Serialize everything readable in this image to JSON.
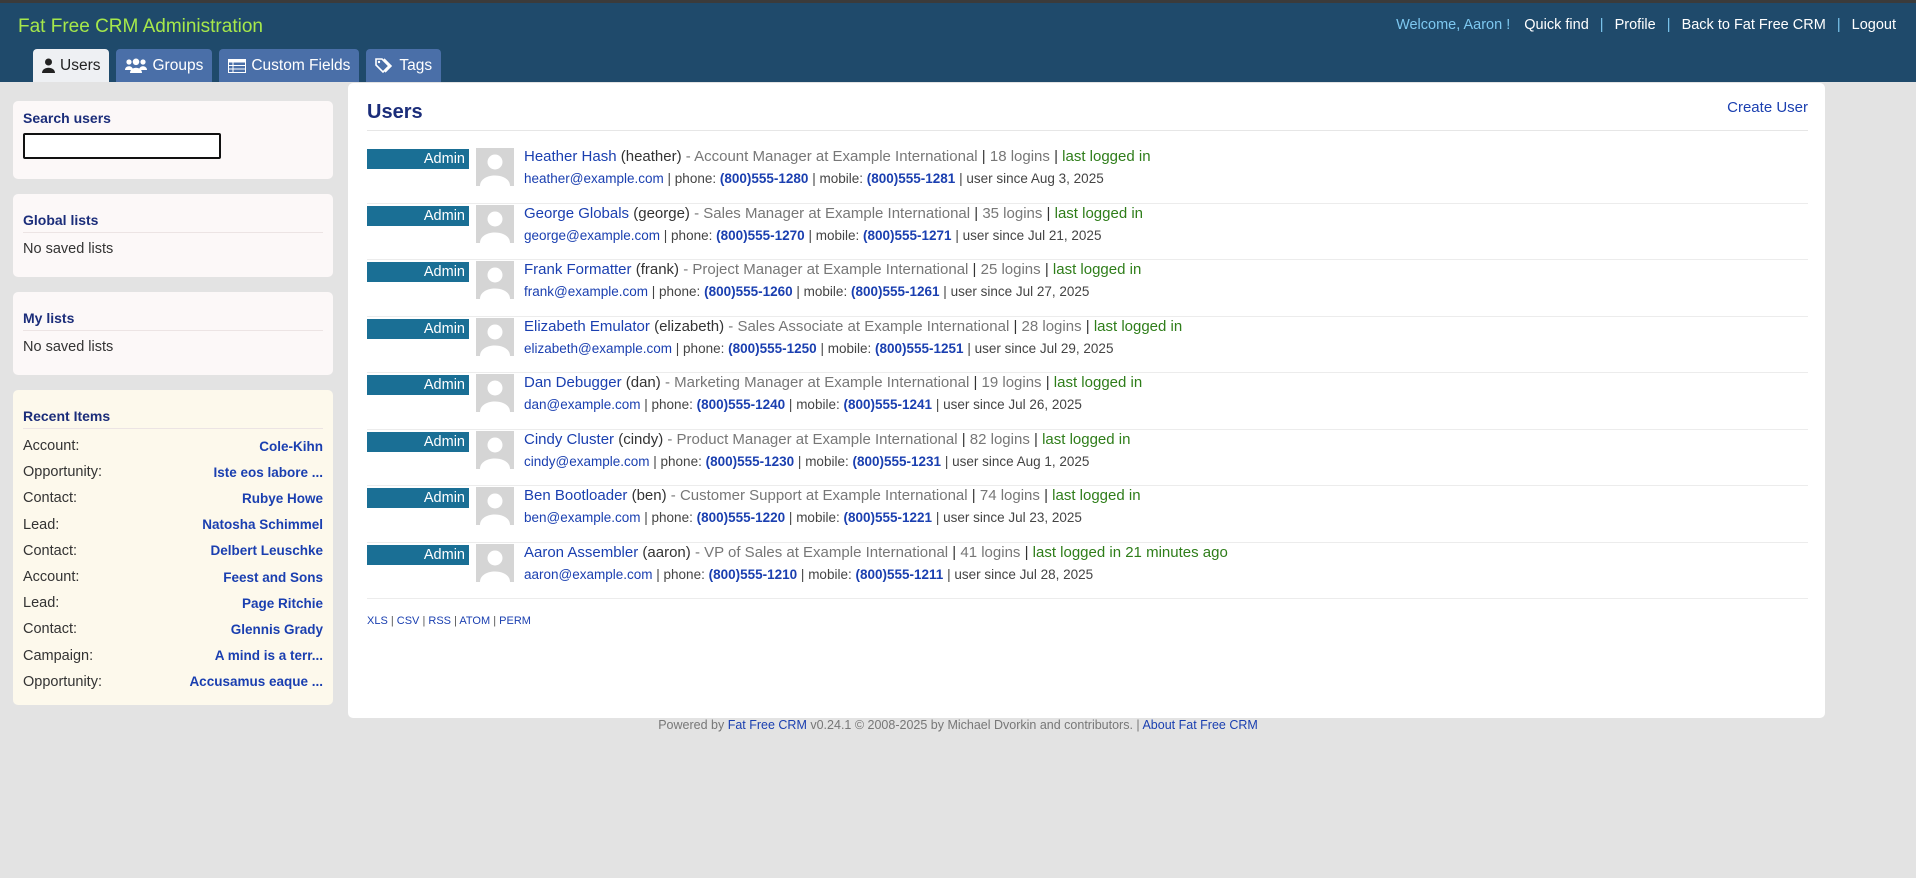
{
  "header": {
    "brand": "Fat Free CRM Administration",
    "welcome": "Welcome, Aaron !",
    "links": [
      "Quick find",
      "Profile",
      "Back to Fat Free CRM",
      "Logout"
    ]
  },
  "tabs": [
    {
      "label": "Users",
      "icon": "user-icon"
    },
    {
      "label": "Groups",
      "icon": "users-icon"
    },
    {
      "label": "Custom Fields",
      "icon": "table-icon"
    },
    {
      "label": "Tags",
      "icon": "tags-icon"
    }
  ],
  "sidebar": {
    "search_title": "Search users",
    "global_title": "Global lists",
    "global_empty": "No saved lists",
    "my_title": "My lists",
    "my_empty": "No saved lists",
    "recent_title": "Recent Items",
    "recent": [
      {
        "type": "Account:",
        "name": "Cole-Kihn"
      },
      {
        "type": "Opportunity:",
        "name": "Iste eos labore ..."
      },
      {
        "type": "Contact:",
        "name": "Rubye Howe"
      },
      {
        "type": "Lead:",
        "name": "Natosha Schimmel"
      },
      {
        "type": "Contact:",
        "name": "Delbert Leuschke"
      },
      {
        "type": "Account:",
        "name": "Feest and Sons"
      },
      {
        "type": "Lead:",
        "name": "Page Ritchie"
      },
      {
        "type": "Contact:",
        "name": "Glennis Grady"
      },
      {
        "type": "Campaign:",
        "name": "A mind is a terr..."
      },
      {
        "type": "Opportunity:",
        "name": "Accusamus eaque ..."
      }
    ]
  },
  "main": {
    "title": "Users",
    "create_label": "Create User",
    "labels": {
      "phone": "phone:",
      "mobile": "mobile:",
      "user_since": "user since"
    },
    "users": [
      {
        "badge": "Admin",
        "name": "Heather Hash",
        "username": "(heather)",
        "title": "- Account Manager at Example International",
        "logins": "18 logins",
        "last": "last logged in",
        "email": "heather@example.com",
        "phone": "(800)555-1280",
        "mobile": "(800)555-1281",
        "since": "Aug 3, 2025"
      },
      {
        "badge": "Admin",
        "name": "George Globals",
        "username": "(george)",
        "title": "- Sales Manager at Example International",
        "logins": "35 logins",
        "last": "last logged in",
        "email": "george@example.com",
        "phone": "(800)555-1270",
        "mobile": "(800)555-1271",
        "since": "Jul 21, 2025"
      },
      {
        "badge": "Admin",
        "name": "Frank Formatter",
        "username": "(frank)",
        "title": "- Project Manager at Example International",
        "logins": "25 logins",
        "last": "last logged in",
        "email": "frank@example.com",
        "phone": "(800)555-1260",
        "mobile": "(800)555-1261",
        "since": "Jul 27, 2025"
      },
      {
        "badge": "Admin",
        "name": "Elizabeth Emulator",
        "username": "(elizabeth)",
        "title": "- Sales Associate at Example International",
        "logins": "28 logins",
        "last": "last logged in",
        "email": "elizabeth@example.com",
        "phone": "(800)555-1250",
        "mobile": "(800)555-1251",
        "since": "Jul 29, 2025"
      },
      {
        "badge": "Admin",
        "name": "Dan Debugger",
        "username": "(dan)",
        "title": "- Marketing Manager at Example International",
        "logins": "19 logins",
        "last": "last logged in",
        "email": "dan@example.com",
        "phone": "(800)555-1240",
        "mobile": "(800)555-1241",
        "since": "Jul 26, 2025"
      },
      {
        "badge": "Admin",
        "name": "Cindy Cluster",
        "username": "(cindy)",
        "title": "- Product Manager at Example International",
        "logins": "82 logins",
        "last": "last logged in",
        "email": "cindy@example.com",
        "phone": "(800)555-1230",
        "mobile": "(800)555-1231",
        "since": "Aug 1, 2025"
      },
      {
        "badge": "Admin",
        "name": "Ben Bootloader",
        "username": "(ben)",
        "title": "- Customer Support at Example International",
        "logins": "74 logins",
        "last": "last logged in",
        "email": "ben@example.com",
        "phone": "(800)555-1220",
        "mobile": "(800)555-1221",
        "since": "Jul 23, 2025"
      },
      {
        "badge": "Admin",
        "name": "Aaron Assembler",
        "username": "(aaron)",
        "title": "- VP of Sales at Example International",
        "logins": "41 logins",
        "last": "last logged in 21 minutes ago",
        "email": "aaron@example.com",
        "phone": "(800)555-1210",
        "mobile": "(800)555-1211",
        "since": "Jul 28, 2025"
      }
    ],
    "exports": [
      "XLS",
      "CSV",
      "RSS",
      "ATOM",
      "PERM"
    ]
  },
  "footer": {
    "prefix": "Powered by",
    "product": "Fat Free CRM",
    "rest": "v0.24.1 © 2008-2025 by Michael Dvorkin and contributors. |",
    "about": "About Fat Free CRM"
  },
  "colors": {
    "header_bg": "#1f4a6b",
    "brand": "#a6e84b",
    "tab_bg": "#4a6fa8",
    "badge_bg": "#1a6f95",
    "link": "#1a3fb0",
    "last_logged": "#2e7d19"
  }
}
